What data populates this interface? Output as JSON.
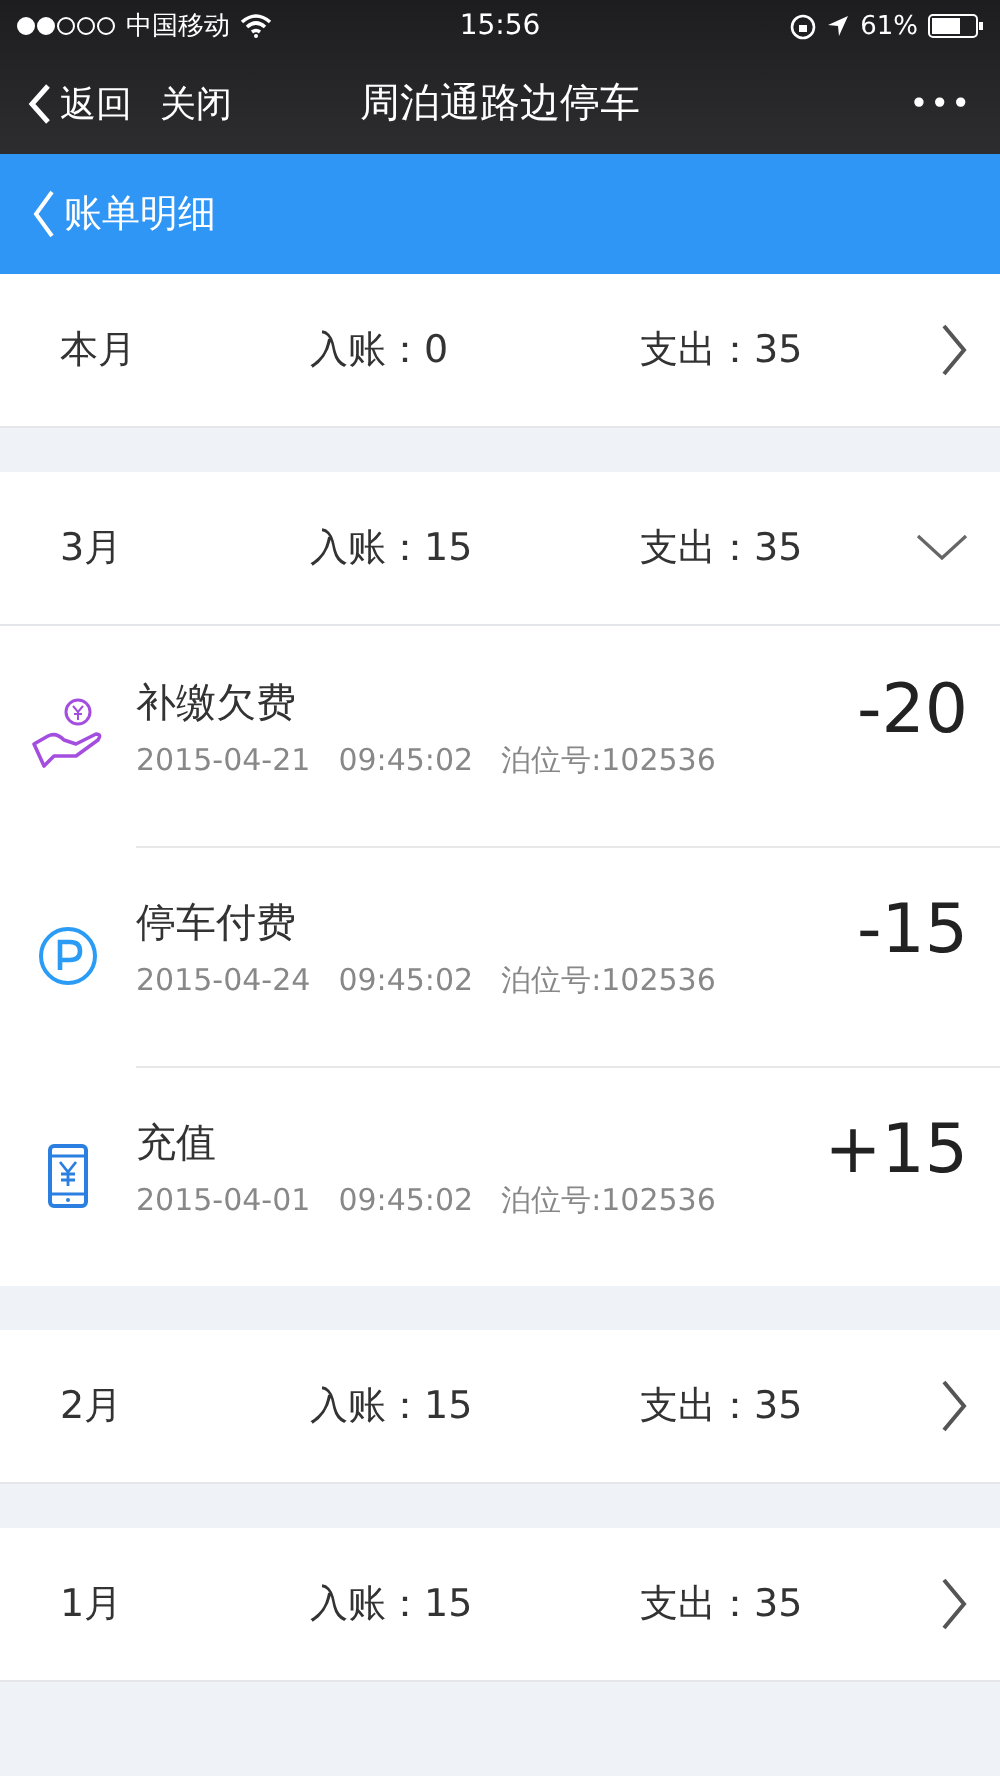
{
  "status_bar": {
    "carrier": "中国移动",
    "time": "15:56",
    "battery": "61%"
  },
  "nav": {
    "back": "返回",
    "close": "关闭",
    "title": "周泊通路边停车",
    "more": "•••"
  },
  "header": {
    "title": "账单明细"
  },
  "months": [
    {
      "name": "本月",
      "income_label": "入账：",
      "income": "0",
      "expense_label": "支出：",
      "expense": "35",
      "expanded": false
    },
    {
      "name": "3月",
      "income_label": "入账：",
      "income": "15",
      "expense_label": "支出：",
      "expense": "35",
      "expanded": true,
      "transactions": [
        {
          "kind": "arrears",
          "title": "补缴欠费",
          "date": "2015-04-21",
          "time": "09:45:02",
          "berth": "泊位号:102536",
          "amount": "-20"
        },
        {
          "kind": "parking",
          "title": "停车付费",
          "date": "2015-04-24",
          "time": "09:45:02",
          "berth": "泊位号:102536",
          "amount": "-15"
        },
        {
          "kind": "topup",
          "title": "充值",
          "date": "2015-04-01",
          "time": "09:45:02",
          "berth": "泊位号:102536",
          "amount": "+15"
        }
      ]
    },
    {
      "name": "2月",
      "income_label": "入账：",
      "income": "15",
      "expense_label": "支出：",
      "expense": "35",
      "expanded": false
    },
    {
      "name": "1月",
      "income_label": "入账：",
      "income": "15",
      "expense_label": "支出：",
      "expense": "35",
      "expanded": false
    }
  ]
}
